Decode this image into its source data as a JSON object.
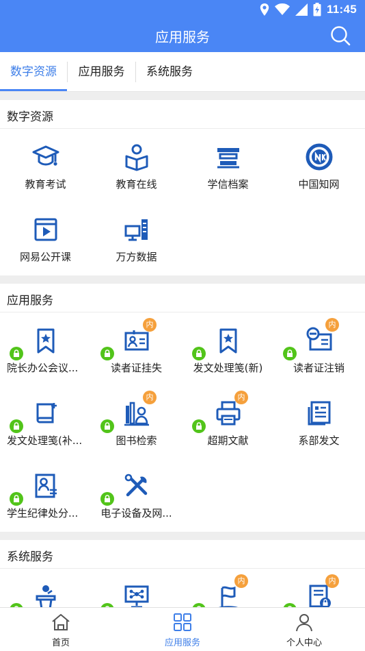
{
  "status_bar": {
    "time": "11:45"
  },
  "header": {
    "title": "应用服务"
  },
  "tabs": [
    {
      "label": "数字资源",
      "active": true
    },
    {
      "label": "应用服务",
      "active": false
    },
    {
      "label": "系统服务",
      "active": false
    }
  ],
  "sections": {
    "digital": {
      "title": "数字资源",
      "items": [
        {
          "label": "教育考试",
          "icon": "graduation-cap-icon"
        },
        {
          "label": "教育在线",
          "icon": "reading-person-icon"
        },
        {
          "label": "学信档案",
          "icon": "archive-stack-icon"
        },
        {
          "label": "中国知网",
          "icon": "cnki-logo-icon"
        },
        {
          "label": "网易公开课",
          "icon": "video-play-icon"
        },
        {
          "label": "万方数据",
          "icon": "computer-server-icon"
        }
      ]
    },
    "app": {
      "title": "应用服务",
      "badge_text": "内",
      "items": [
        {
          "label": "院长办公会议...",
          "icon": "bookmark-star-icon",
          "lock": true,
          "badge": false
        },
        {
          "label": "读者证挂失",
          "icon": "id-card-icon",
          "lock": true,
          "badge": true
        },
        {
          "label": "发文处理笺(新)",
          "icon": "bookmark-star-icon",
          "lock": true,
          "badge": false
        },
        {
          "label": "读者证注销",
          "icon": "card-cancel-icon",
          "lock": true,
          "badge": true
        },
        {
          "label": "发文处理笺(补...",
          "icon": "book-plus-icon",
          "lock": true,
          "badge": false
        },
        {
          "label": "图书检索",
          "icon": "bookshelf-person-icon",
          "lock": true,
          "badge": true
        },
        {
          "label": "超期文献",
          "icon": "printer-icon",
          "lock": true,
          "badge": true
        },
        {
          "label": "系部发文",
          "icon": "document-icon",
          "lock": false,
          "badge": false
        },
        {
          "label": "学生纪律处分...",
          "icon": "person-document-icon",
          "lock": true,
          "badge": false
        },
        {
          "label": "电子设备及网...",
          "icon": "tools-icon",
          "lock": true,
          "badge": false
        }
      ]
    },
    "system": {
      "title": "系统服务",
      "items": [
        {
          "icon": "speaker-podium-icon",
          "lock": true,
          "badge": false
        },
        {
          "icon": "network-monitor-icon",
          "lock": true,
          "badge": false
        },
        {
          "icon": "flag-icon",
          "lock": true,
          "badge": true
        },
        {
          "icon": "doc-lock-icon",
          "lock": true,
          "badge": true
        }
      ]
    }
  },
  "bottom_nav": [
    {
      "label": "首页",
      "icon": "home-icon",
      "active": false
    },
    {
      "label": "应用服务",
      "icon": "grid-icon",
      "active": true
    },
    {
      "label": "个人中心",
      "icon": "user-icon",
      "active": false
    }
  ],
  "colors": {
    "primary": "#4a86f5",
    "icon_blue": "#1e5bb8",
    "badge": "#f5a03c",
    "lock": "#52c41a"
  }
}
